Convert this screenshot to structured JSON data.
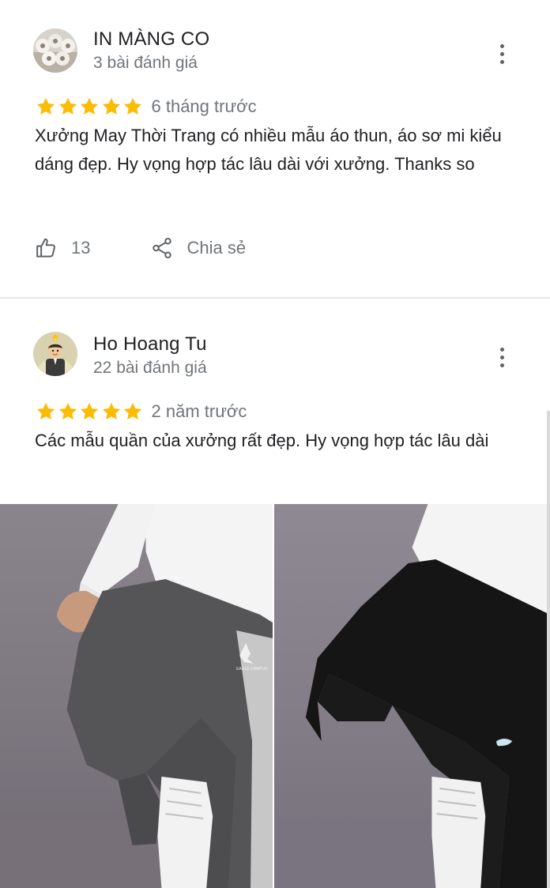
{
  "reviews": [
    {
      "author": "IN MÀNG CO",
      "meta": "3 bài đánh giá",
      "rating": 5,
      "time": "6 tháng trước",
      "text": "Xưởng May Thời Trang có nhiều mẫu áo thun, áo sơ mi kiểu dáng đẹp. Hy vọng hợp tác lâu dài với xưởng. Thanks so",
      "likes": "13",
      "share_label": "Chia sẻ",
      "avatar_icon": "plastic-roll-avatar",
      "more_icon": "more-vertical-icon"
    },
    {
      "author": "Ho Hoang Tu",
      "meta": "22 bài đánh giá",
      "rating": 5,
      "time": "2 năm trước",
      "text": "Các mẫu quần của xưởng rất đẹp. Hy vọng hợp tác lâu dài",
      "avatar_icon": "cartoon-person-avatar",
      "more_icon": "more-vertical-icon",
      "photos": [
        {
          "name": "grey-jogger-pants-photo",
          "logo_text": "EAGLE CAMPUS"
        },
        {
          "name": "black-jogger-pants-photo"
        }
      ]
    }
  ],
  "colors": {
    "star": "#fbbc04",
    "secondary_text": "#70757a",
    "primary_text": "#202124",
    "divider": "#e6e6e6"
  }
}
